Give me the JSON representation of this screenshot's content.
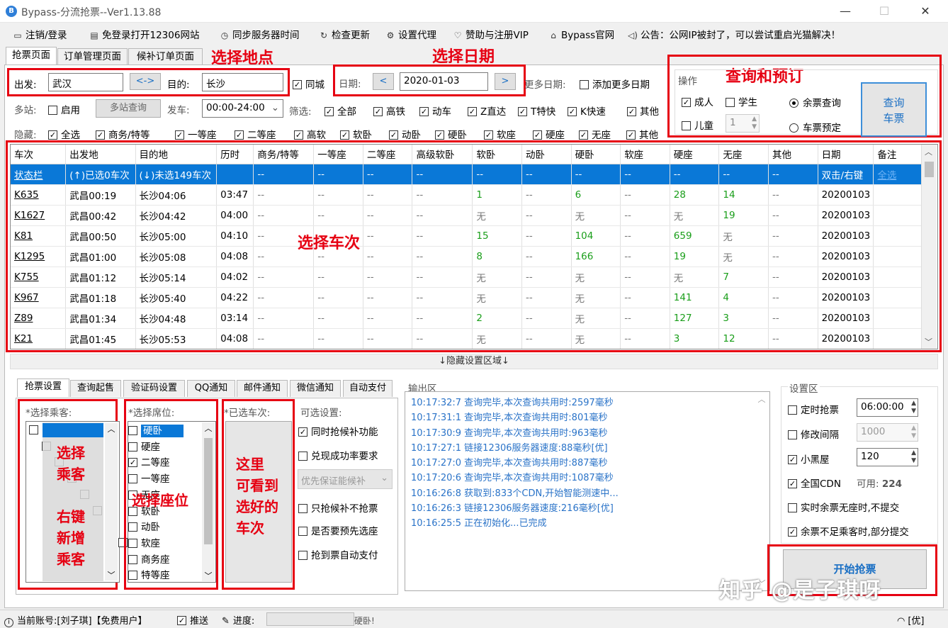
{
  "window": {
    "title": "Bypass-分流抢票--Ver1.13.88",
    "icon": "B"
  },
  "menu": [
    "注销/登录",
    "免登录打开12306网站",
    "同步服务器时间",
    "检查更新",
    "设置代理",
    "赞助与注册VIP",
    "Bypass官网",
    "公告：公网IP被封了，可以尝试重启光猫解决！"
  ],
  "tabs": [
    "抢票页面",
    "订单管理页面",
    "候补订单页面"
  ],
  "annotations": {
    "location": "选择地点",
    "date": "选择日期",
    "query": "查询和预订",
    "train": "选择车次",
    "passenger_line1": "选择",
    "passenger_line2": "乘客",
    "passenger_line3": "右键",
    "passenger_line4": "新增",
    "passenger_line5": "乘客",
    "seat": "选择座位",
    "chosen_line1": "这里",
    "chosen_line2": "可看到",
    "chosen_line3": "选好的",
    "chosen_line4": "车次"
  },
  "search": {
    "from_label": "出发:",
    "from_value": "武汉",
    "swap_label": "<->",
    "to_label": "目的:",
    "to_value": "长沙",
    "same_city_label": "同城",
    "date_label": "日期:",
    "date_value": "2020-01-03",
    "prev": "<",
    "next": ">",
    "more_dates_label": "更多日期:",
    "add_dates_label": "添加更多日期",
    "multi_station_label": "多站:",
    "multi_enable": "启用",
    "multi_query": "多站查询",
    "depart_label": "发车:",
    "depart_value": "00:00-24:00",
    "filter_label": "筛选:",
    "filters": [
      "全部",
      "高铁",
      "动车",
      "Z直达",
      "T特快",
      "K快速",
      "其他"
    ],
    "hide_label": "隐藏:",
    "hides": [
      "全选",
      "商务/特等",
      "一等座",
      "二等座",
      "高软",
      "软卧",
      "动卧",
      "硬卧",
      "软座",
      "硬座",
      "无座",
      "其他"
    ]
  },
  "ops": {
    "title": "操作",
    "adult": "成人",
    "student": "学生",
    "child": "儿童",
    "child_count": "1",
    "remain_query": "余票查询",
    "reserve": "车票预定",
    "query_btn_1": "查询",
    "query_btn_2": "车票"
  },
  "grid": {
    "headers": [
      "车次",
      "出发地",
      "目的地",
      "历时",
      "商务/特等",
      "一等座",
      "二等座",
      "高级软卧",
      "软卧",
      "动卧",
      "硬卧",
      "软座",
      "硬座",
      "无座",
      "其他",
      "日期",
      "备注"
    ],
    "rows": [
      [
        "状态栏",
        "(↑)已选0车次",
        "(↓)未选149车次",
        "",
        "--",
        "--",
        "--",
        "--",
        "--",
        "--",
        "--",
        "--",
        "--",
        "--",
        "--",
        "双击/右键",
        "全选"
      ],
      [
        "K635",
        "武昌00:19",
        "长沙04:06",
        "03:47",
        "--",
        "--",
        "--",
        "--",
        "1",
        "--",
        "6",
        "--",
        "28",
        "14",
        "--",
        "20200103",
        ""
      ],
      [
        "K1627",
        "武昌00:42",
        "长沙04:42",
        "04:00",
        "--",
        "--",
        "--",
        "--",
        "无",
        "--",
        "无",
        "--",
        "无",
        "19",
        "--",
        "20200103",
        ""
      ],
      [
        "K81",
        "武昌00:50",
        "长沙05:00",
        "04:10",
        "--",
        "--",
        "--",
        "--",
        "15",
        "--",
        "104",
        "--",
        "659",
        "无",
        "--",
        "20200103",
        ""
      ],
      [
        "K1295",
        "武昌01:00",
        "长沙05:08",
        "04:08",
        "--",
        "--",
        "--",
        "--",
        "8",
        "--",
        "166",
        "--",
        "19",
        "无",
        "--",
        "20200103",
        ""
      ],
      [
        "K755",
        "武昌01:12",
        "长沙05:14",
        "04:02",
        "--",
        "--",
        "--",
        "--",
        "无",
        "--",
        "无",
        "--",
        "无",
        "7",
        "--",
        "20200103",
        ""
      ],
      [
        "K967",
        "武昌01:18",
        "长沙05:40",
        "04:22",
        "--",
        "--",
        "--",
        "--",
        "无",
        "--",
        "无",
        "--",
        "141",
        "4",
        "--",
        "20200103",
        ""
      ],
      [
        "Z89",
        "武昌01:34",
        "长沙04:48",
        "03:14",
        "--",
        "--",
        "--",
        "--",
        "2",
        "--",
        "无",
        "--",
        "127",
        "3",
        "--",
        "20200103",
        ""
      ],
      [
        "K21",
        "武昌01:45",
        "长沙05:53",
        "04:08",
        "--",
        "--",
        "--",
        "--",
        "无",
        "--",
        "无",
        "--",
        "3",
        "12",
        "--",
        "20200103",
        ""
      ]
    ]
  },
  "hide_settings": "↓隐藏设置区域↓",
  "bottom_tabs": [
    "抢票设置",
    "查询起售",
    "验证码设置",
    "QQ通知",
    "邮件通知",
    "微信通知",
    "自动支付"
  ],
  "passenger": {
    "label": "*选择乘客:"
  },
  "seats": {
    "label": "*选择席位:",
    "items": [
      "硬卧",
      "硬座",
      "二等座",
      "一等座",
      "无座",
      "软卧",
      "动卧",
      "软座",
      "商务座",
      "特等座"
    ]
  },
  "chosen": {
    "label": "*已选车次:"
  },
  "options": {
    "label": "可选设置:",
    "items": [
      "同时抢候补功能",
      "兑现成功率要求",
      "只抢候补不抢票",
      "是否要预先选座",
      "抢到票自动支付"
    ],
    "dropdown": "优先保证能候补"
  },
  "output": {
    "label": "输出区",
    "lines": [
      "10:17:32:7  查询完毕,本次查询共用时:2597毫秒",
      "10:17:31:1  查询完毕,本次查询共用时:801毫秒",
      "10:17:30:9  查询完毕,本次查询共用时:963毫秒",
      "10:17:27:1  链接12306服务器速度:88毫秒[优]",
      "10:17:27:0  查询完毕,本次查询共用时:887毫秒",
      "10:17:20:6  查询完毕,本次查询共用时:1087毫秒",
      "10:16:26:8  获取到:833个CDN,开始智能测速中...",
      "10:16:26:3  链接12306服务器速度:216毫秒[优]",
      "10:16:25:5  正在初始化...已完成"
    ]
  },
  "settings": {
    "label": "设置区",
    "timed": "定时抢票",
    "timed_value": "06:00:00",
    "interval": "修改间隔",
    "interval_value": "1000",
    "blackroom": "小黑屋",
    "blackroom_value": "120",
    "cdn": "全国CDN",
    "cdn_avail_label": "可用:",
    "cdn_avail_value": "224",
    "realtime": "实时余票无座时,不提交",
    "partial": "余票不足乘客时,部分提交",
    "start_btn": "开始抢票"
  },
  "watermark": "知乎 @是子琪呀",
  "status": {
    "account": "当前账号:[刘子琪]【免费用户】",
    "push": "推送",
    "progress_label": "进度:",
    "tail": "硬卧!",
    "net": "[优]"
  },
  "colors": {
    "accent": "#0a78d7",
    "annotation": "#e60012",
    "green": "#1a9e1a",
    "output": "#2a73c8"
  }
}
